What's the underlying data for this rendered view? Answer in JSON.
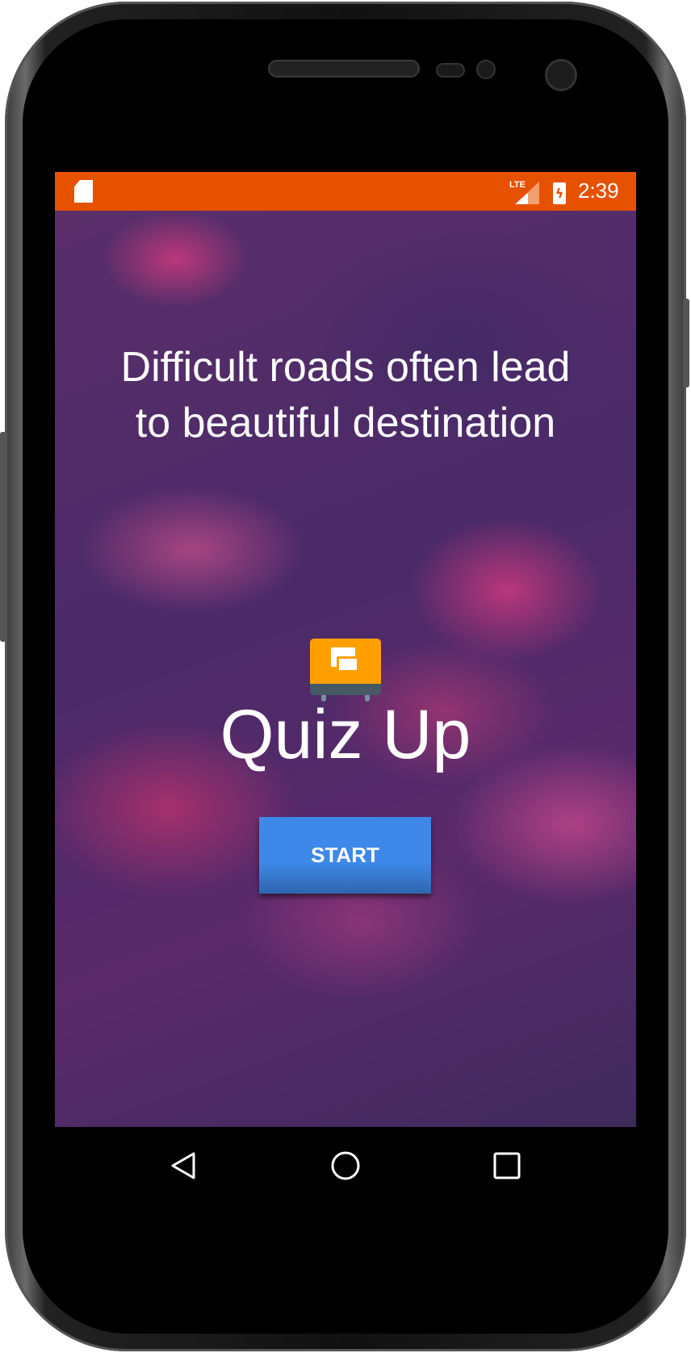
{
  "status_bar": {
    "network": "LTE",
    "time": "2:39",
    "color": "#e65100"
  },
  "main": {
    "quote": "Difficult roads often lead to beautiful destination",
    "app_title": "Quiz Up",
    "start_label": "START",
    "button_color": "#3d88e8"
  },
  "nav": {
    "back": "back-icon",
    "home": "home-icon",
    "recents": "recents-icon"
  }
}
